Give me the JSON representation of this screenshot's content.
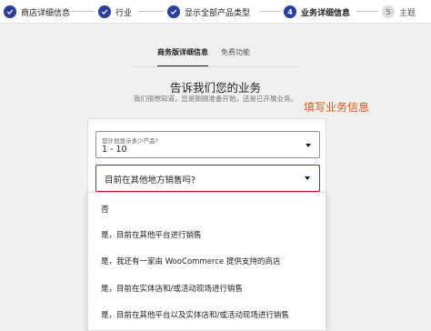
{
  "stepper": {
    "steps": [
      {
        "label": "商店详细信息",
        "status": "done"
      },
      {
        "label": "行业",
        "status": "done"
      },
      {
        "label": "显示全部产品类型",
        "status": "done"
      },
      {
        "label": "业务详细信息",
        "number": "4",
        "status": "current"
      },
      {
        "label": "主题",
        "number": "5",
        "status": "future"
      }
    ]
  },
  "tabs": [
    {
      "label": "商务版详细信息",
      "active": true
    },
    {
      "label": "免费功能",
      "active": false
    }
  ],
  "header": {
    "title": "告诉我们您的业务",
    "subtitle": "我们很想知道，您是刚刚准备开始，还是已开展业务。"
  },
  "annotation": "填写业务信息",
  "form": {
    "products_count": {
      "label": "您计划显示多少产品?",
      "value": "1 - 10"
    },
    "selling_elsewhere": {
      "placeholder": "目前在其他地方销售吗?",
      "options": [
        "否",
        "是，目前在其他平台进行销售",
        "是，我还有一家由 WooCommerce 提供支持的商店",
        "是，目前在实体店和/或活动现场进行销售",
        "是，目前在其他平台以及实体店和/或活动现场进行销售"
      ]
    }
  },
  "colors": {
    "accent": "#2b3e9b",
    "error_border": "#c8102e",
    "annotation": "#e2541a"
  }
}
